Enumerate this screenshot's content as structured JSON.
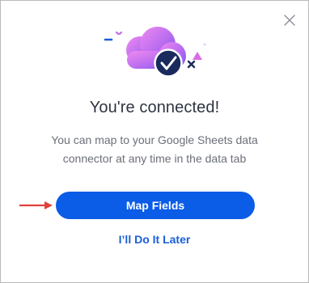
{
  "dialog": {
    "close_icon": "close-icon",
    "illustration_icons": [
      "cloud-icon",
      "checkmark-circle-icon",
      "confetti-icon"
    ],
    "title": "You're connected!",
    "message": "You can map to your Google Sheets data connector at any time in the data tab",
    "primary_button_label": "Map Fields",
    "secondary_link_label": "I’ll Do It Later",
    "pointer_icon": "arrow-right-icon"
  },
  "colors": {
    "primary": "#0b5ce6",
    "link": "#1a5fd8",
    "title": "#2f3440",
    "body_text": "#6b6f78",
    "arrow": "#e0413d",
    "cloud_pink": "#ee7df0",
    "cloud_purple": "#8b5cf6",
    "check_circle": "#1a2a5c",
    "border": "#b9b9b9"
  }
}
